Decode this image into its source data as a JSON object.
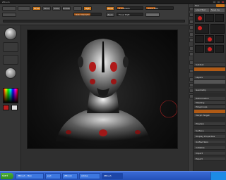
{
  "window": {
    "title": "ZBrush"
  },
  "taskbar": {
    "start_label": "start",
    "tasks": [
      "ZBrush - Man",
      "psd",
      "ZBrush",
      "Adobe",
      "ZBrush"
    ],
    "active_index": 4,
    "clock": ""
  },
  "colors": {
    "accent": "#c7741b",
    "selection": "#b05a15",
    "primary_swatch": "#b81c1c",
    "secondary_swatch": "#e0e0e0"
  },
  "toolbar": {
    "draw_label": "Draw",
    "move_label": "Move",
    "scale_label": "Scale",
    "rotate_label": "Rotate",
    "zadd_label": "Zadd",
    "zsub_label": "Zsub",
    "rgb_label": "Rgb",
    "focal_shift_label": "Focal Shift",
    "draw_size_label": "Draw Size",
    "z_intensity_label": "Z Intensity",
    "rgb_intensity_label": "Rgb Intensity",
    "draw_size_value": 0.35,
    "z_intensity_value": 0.25,
    "rgb_intensity_value": 0.6
  },
  "canvas": {
    "caption": ""
  },
  "tool_palette": {
    "header": "Tool",
    "load_label": "Load Tool",
    "save_label": "Save As",
    "items": [
      "Subtool",
      "Layers",
      "Geometry",
      "Deformation",
      "Masking",
      "Polygroups",
      "Morph Target",
      "Preview",
      "Surface",
      "Display Properties",
      "Unified Skin",
      "Initialize",
      "Import",
      "Export"
    ]
  }
}
